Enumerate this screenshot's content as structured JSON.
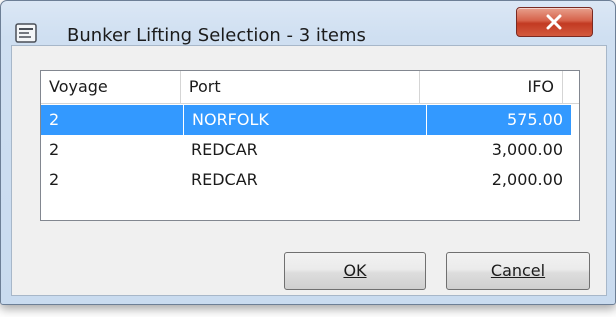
{
  "window": {
    "title": "Bunker Lifting Selection - 3 items"
  },
  "icons": {
    "app": "document-window-icon",
    "close": "close-x-icon"
  },
  "list": {
    "columns": [
      {
        "label": "Voyage"
      },
      {
        "label": "Port"
      },
      {
        "label": "IFO"
      }
    ],
    "rows": [
      {
        "voyage": "2",
        "port": "NORFOLK",
        "ifo": "575.00",
        "selected": true
      },
      {
        "voyage": "2",
        "port": "REDCAR",
        "ifo": "3,000.00",
        "selected": false
      },
      {
        "voyage": "2",
        "port": "REDCAR",
        "ifo": "2,000.00",
        "selected": false
      }
    ]
  },
  "buttons": {
    "ok_label": "OK",
    "cancel_label": "Cancel"
  },
  "colors": {
    "selection": "#3399ff",
    "close_button": "#c23a22"
  }
}
